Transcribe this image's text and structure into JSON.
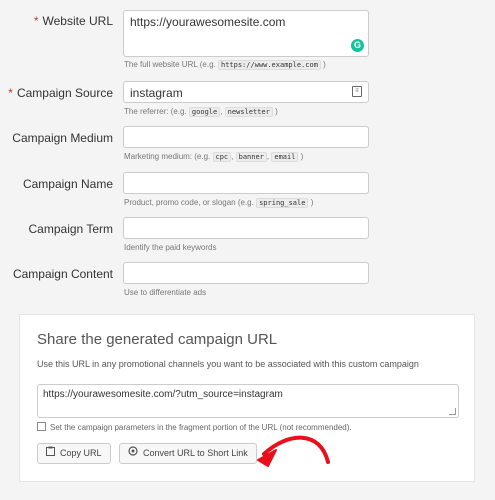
{
  "form": {
    "website_url": {
      "label": "Website URL",
      "required": true,
      "value": "https://yourawesomesite.com",
      "help_prefix": "The full website URL (e.g.",
      "help_code": "https://www.example.com",
      "help_suffix": ")"
    },
    "campaign_source": {
      "label": "Campaign Source",
      "required": true,
      "value": "instagram",
      "help_prefix": "The referrer: (e.g.",
      "help_codes": [
        "google",
        "newsletter"
      ],
      "help_suffix": ")"
    },
    "campaign_medium": {
      "label": "Campaign Medium",
      "value": "",
      "help_prefix": "Marketing medium: (e.g.",
      "help_codes": [
        "cpc",
        "banner",
        "email"
      ],
      "help_suffix": ")"
    },
    "campaign_name": {
      "label": "Campaign Name",
      "value": "",
      "help_prefix": "Product, promo code, or slogan (e.g.",
      "help_code": "spring_sale",
      "help_suffix": ")"
    },
    "campaign_term": {
      "label": "Campaign Term",
      "value": "",
      "help": "Identify the paid keywords"
    },
    "campaign_content": {
      "label": "Campaign Content",
      "value": "",
      "help": "Use to differentiate ads"
    },
    "required_marker": "*"
  },
  "panel": {
    "title": "Share the generated campaign URL",
    "description": "Use this URL in any promotional channels you want to be associated with this custom campaign",
    "generated_url": "https://yourawesomesite.com/?utm_source=instagram",
    "fragment_checkbox_label": "Set the campaign parameters in the fragment portion of the URL (not recommended).",
    "fragment_checked": false,
    "copy_button": "Copy URL",
    "short_link_button": "Convert URL to Short Link"
  },
  "icons": {
    "grammarly": "grammarly-icon",
    "autofill": "autofill-icon",
    "copy": "clipboard-icon",
    "short_link": "link-icon"
  },
  "colors": {
    "required": "#c0392b",
    "arrow": "#e8101a",
    "grammarly": "#15c39a"
  }
}
